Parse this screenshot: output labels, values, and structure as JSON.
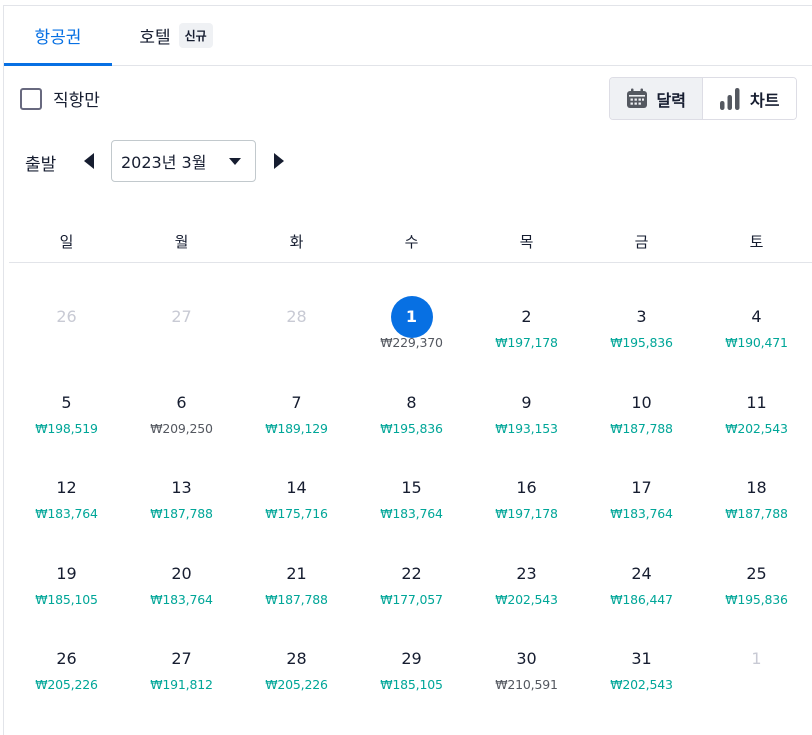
{
  "tabs": [
    {
      "label": "항공권",
      "active": true
    },
    {
      "label": "호텔",
      "active": false,
      "badge": "신규"
    }
  ],
  "filters": {
    "direct_only_label": "직항만",
    "direct_only_checked": false
  },
  "view_toggle": {
    "calendar_label": "달력",
    "chart_label": "차트",
    "active": "calendar"
  },
  "departure": {
    "label": "출발",
    "month": "2023년 3월"
  },
  "weekdays": [
    "일",
    "월",
    "화",
    "수",
    "목",
    "금",
    "토"
  ],
  "calendar": {
    "weeks": [
      [
        {
          "day": "26",
          "outside": true
        },
        {
          "day": "27",
          "outside": true
        },
        {
          "day": "28",
          "outside": true
        },
        {
          "day": "1",
          "price": "₩229,370",
          "selected": true,
          "cheap": false
        },
        {
          "day": "2",
          "price": "₩197,178",
          "cheap": true
        },
        {
          "day": "3",
          "price": "₩195,836",
          "cheap": true
        },
        {
          "day": "4",
          "price": "₩190,471",
          "cheap": true
        }
      ],
      [
        {
          "day": "5",
          "price": "₩198,519",
          "cheap": true
        },
        {
          "day": "6",
          "price": "₩209,250",
          "cheap": false
        },
        {
          "day": "7",
          "price": "₩189,129",
          "cheap": true
        },
        {
          "day": "8",
          "price": "₩195,836",
          "cheap": true
        },
        {
          "day": "9",
          "price": "₩193,153",
          "cheap": true
        },
        {
          "day": "10",
          "price": "₩187,788",
          "cheap": true
        },
        {
          "day": "11",
          "price": "₩202,543",
          "cheap": true
        }
      ],
      [
        {
          "day": "12",
          "price": "₩183,764",
          "cheap": true
        },
        {
          "day": "13",
          "price": "₩187,788",
          "cheap": true
        },
        {
          "day": "14",
          "price": "₩175,716",
          "cheap": true
        },
        {
          "day": "15",
          "price": "₩183,764",
          "cheap": true
        },
        {
          "day": "16",
          "price": "₩197,178",
          "cheap": true
        },
        {
          "day": "17",
          "price": "₩183,764",
          "cheap": true
        },
        {
          "day": "18",
          "price": "₩187,788",
          "cheap": true
        }
      ],
      [
        {
          "day": "19",
          "price": "₩185,105",
          "cheap": true
        },
        {
          "day": "20",
          "price": "₩183,764",
          "cheap": true
        },
        {
          "day": "21",
          "price": "₩187,788",
          "cheap": true
        },
        {
          "day": "22",
          "price": "₩177,057",
          "cheap": true
        },
        {
          "day": "23",
          "price": "₩202,543",
          "cheap": true
        },
        {
          "day": "24",
          "price": "₩186,447",
          "cheap": true
        },
        {
          "day": "25",
          "price": "₩195,836",
          "cheap": true
        }
      ],
      [
        {
          "day": "26",
          "price": "₩205,226",
          "cheap": true
        },
        {
          "day": "27",
          "price": "₩191,812",
          "cheap": true
        },
        {
          "day": "28",
          "price": "₩205,226",
          "cheap": true
        },
        {
          "day": "29",
          "price": "₩185,105",
          "cheap": true
        },
        {
          "day": "30",
          "price": "₩210,591",
          "cheap": false
        },
        {
          "day": "31",
          "price": "₩202,543",
          "cheap": true
        },
        {
          "day": "1",
          "outside": true
        }
      ]
    ]
  },
  "colors": {
    "accent": "#0770e3",
    "cheap_price": "#00a698",
    "normal_price": "#545860",
    "outside_day": "#c8cad4"
  },
  "icons": {
    "calendar": "calendar-icon",
    "chart": "bar-chart-icon",
    "prev": "arrow-left-icon",
    "next": "arrow-right-icon",
    "dropdown": "caret-down-icon"
  }
}
